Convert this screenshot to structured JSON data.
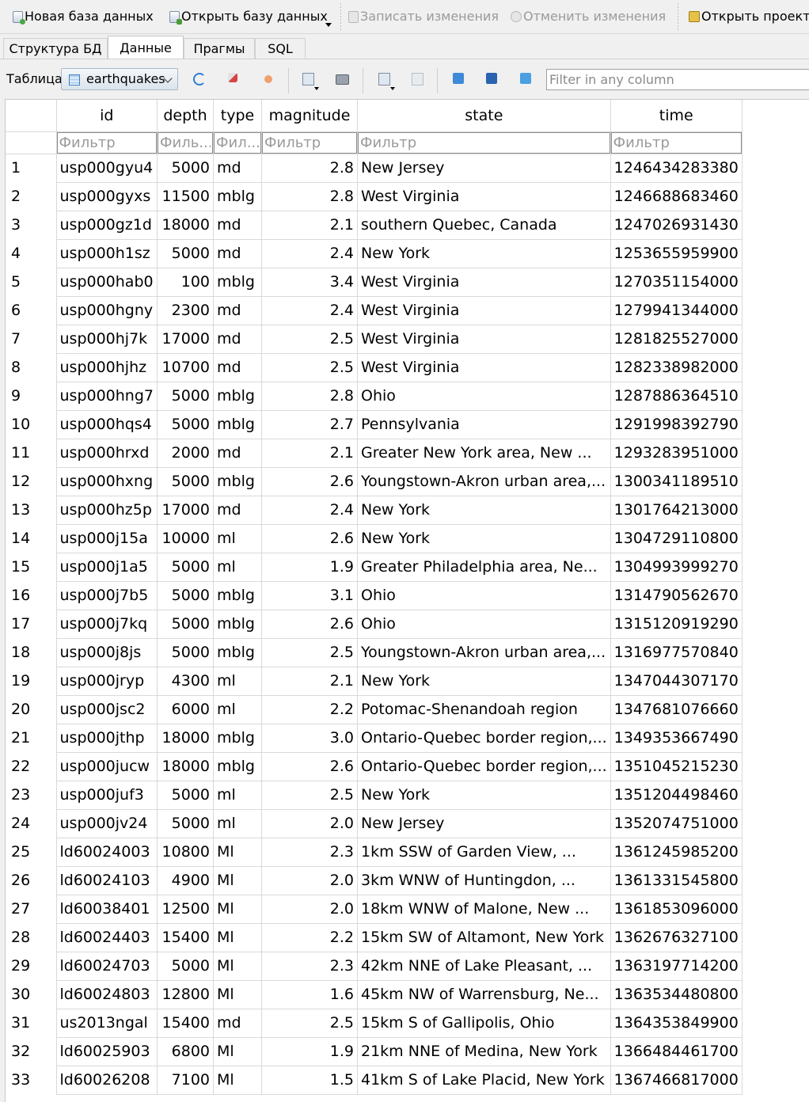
{
  "toolbar": {
    "new_db": "Новая база данных",
    "open_db": "Открыть базу данных",
    "write_changes": "Записать изменения",
    "revert_changes": "Отменить изменения",
    "open_project": "Открыть проект"
  },
  "tabs": [
    "Структура БД",
    "Данные",
    "Прагмы",
    "SQL"
  ],
  "active_tab": "Данные",
  "table_bar": {
    "label": "Таблица:",
    "selected_table": "earthquakes",
    "filter_placeholder": "Filter in any column"
  },
  "grid": {
    "columns": [
      "id",
      "depth",
      "type",
      "magnitude",
      "state",
      "time"
    ],
    "filter_placeholders": [
      "Фильтр",
      "Филь...",
      "Фил...",
      "Фильтр",
      "Фильтр",
      "Фильтр"
    ],
    "rows": [
      [
        "1",
        "usp000gyu4",
        "5000",
        "md",
        "2.8",
        "New Jersey",
        "1246434283380"
      ],
      [
        "2",
        "usp000gyxs",
        "11500",
        "mblg",
        "2.8",
        "West Virginia",
        "1246688683460"
      ],
      [
        "3",
        "usp000gz1d",
        "18000",
        "md",
        "2.1",
        "southern Quebec, Canada",
        "1247026931430"
      ],
      [
        "4",
        "usp000h1sz",
        "5000",
        "md",
        "2.4",
        "New York",
        "1253655959900"
      ],
      [
        "5",
        "usp000hab0",
        "100",
        "mblg",
        "3.4",
        "West Virginia",
        "1270351154000"
      ],
      [
        "6",
        "usp000hgny",
        "2300",
        "md",
        "2.4",
        "West Virginia",
        "1279941344000"
      ],
      [
        "7",
        "usp000hj7k",
        "17000",
        "md",
        "2.5",
        "West Virginia",
        "1281825527000"
      ],
      [
        "8",
        "usp000hjhz",
        "10700",
        "md",
        "2.5",
        "West Virginia",
        "1282338982000"
      ],
      [
        "9",
        "usp000hng7",
        "5000",
        "mblg",
        "2.8",
        "Ohio",
        "1287886364510"
      ],
      [
        "10",
        "usp000hqs4",
        "5000",
        "mblg",
        "2.7",
        "Pennsylvania",
        "1291998392790"
      ],
      [
        "11",
        "usp000hrxd",
        "2000",
        "md",
        "2.1",
        "Greater New York area, New ...",
        "1293283951000"
      ],
      [
        "12",
        "usp000hxng",
        "5000",
        "mblg",
        "2.6",
        "Youngstown-Akron urban area,...",
        "1300341189510"
      ],
      [
        "13",
        "usp000hz5p",
        "17000",
        "md",
        "2.4",
        "New York",
        "1301764213000"
      ],
      [
        "14",
        "usp000j15a",
        "10000",
        "ml",
        "2.6",
        "New York",
        "1304729110800"
      ],
      [
        "15",
        "usp000j1a5",
        "5000",
        "ml",
        "1.9",
        "Greater Philadelphia area, Ne...",
        "1304993999270"
      ],
      [
        "16",
        "usp000j7b5",
        "5000",
        "mblg",
        "3.1",
        "Ohio",
        "1314790562670"
      ],
      [
        "17",
        "usp000j7kq",
        "5000",
        "mblg",
        "2.6",
        "Ohio",
        "1315120919290"
      ],
      [
        "18",
        "usp000j8js",
        "5000",
        "mblg",
        "2.5",
        "Youngstown-Akron urban area,...",
        "1316977570840"
      ],
      [
        "19",
        "usp000jryp",
        "4300",
        "ml",
        "2.1",
        "New York",
        "1347044307170"
      ],
      [
        "20",
        "usp000jsc2",
        "6000",
        "ml",
        "2.2",
        "Potomac-Shenandoah region",
        "1347681076660"
      ],
      [
        "21",
        "usp000jthp",
        "18000",
        "mblg",
        "3.0",
        "Ontario-Quebec border region,...",
        "1349353667490"
      ],
      [
        "22",
        "usp000jucw",
        "18000",
        "mblg",
        "2.6",
        "Ontario-Quebec border region,...",
        "1351045215230"
      ],
      [
        "23",
        "usp000juf3",
        "5000",
        "ml",
        "2.5",
        "New York",
        "1351204498460"
      ],
      [
        "24",
        "usp000jv24",
        "5000",
        "ml",
        "2.0",
        "New Jersey",
        "1352074751000"
      ],
      [
        "25",
        "ld60024003",
        "10800",
        "Ml",
        "2.3",
        "1km SSW of Garden View, ...",
        "1361245985200"
      ],
      [
        "26",
        "ld60024103",
        "4900",
        "Ml",
        "2.0",
        "3km WNW of Huntingdon, ...",
        "1361331545800"
      ],
      [
        "27",
        "ld60038401",
        "12500",
        "Ml",
        "2.0",
        "18km WNW of Malone, New ...",
        "1361853096000"
      ],
      [
        "28",
        "ld60024403",
        "15400",
        "Ml",
        "2.2",
        "15km SW of Altamont, New York",
        "1362676327100"
      ],
      [
        "29",
        "ld60024703",
        "5000",
        "Ml",
        "2.3",
        "42km NNE of Lake Pleasant, ...",
        "1363197714200"
      ],
      [
        "30",
        "ld60024803",
        "12800",
        "Ml",
        "1.6",
        "45km NW of Warrensburg, Ne...",
        "1363534480800"
      ],
      [
        "31",
        "us2013ngal",
        "15400",
        "md",
        "2.5",
        "15km S of Gallipolis, Ohio",
        "1364353849900"
      ],
      [
        "32",
        "ld60025903",
        "6800",
        "Ml",
        "1.9",
        "21km NNE of Medina, New York",
        "1366484461700"
      ],
      [
        "33",
        "ld60026208",
        "7100",
        "Ml",
        "1.5",
        "41km S of Lake Placid, New York",
        "1367466817000"
      ]
    ]
  }
}
